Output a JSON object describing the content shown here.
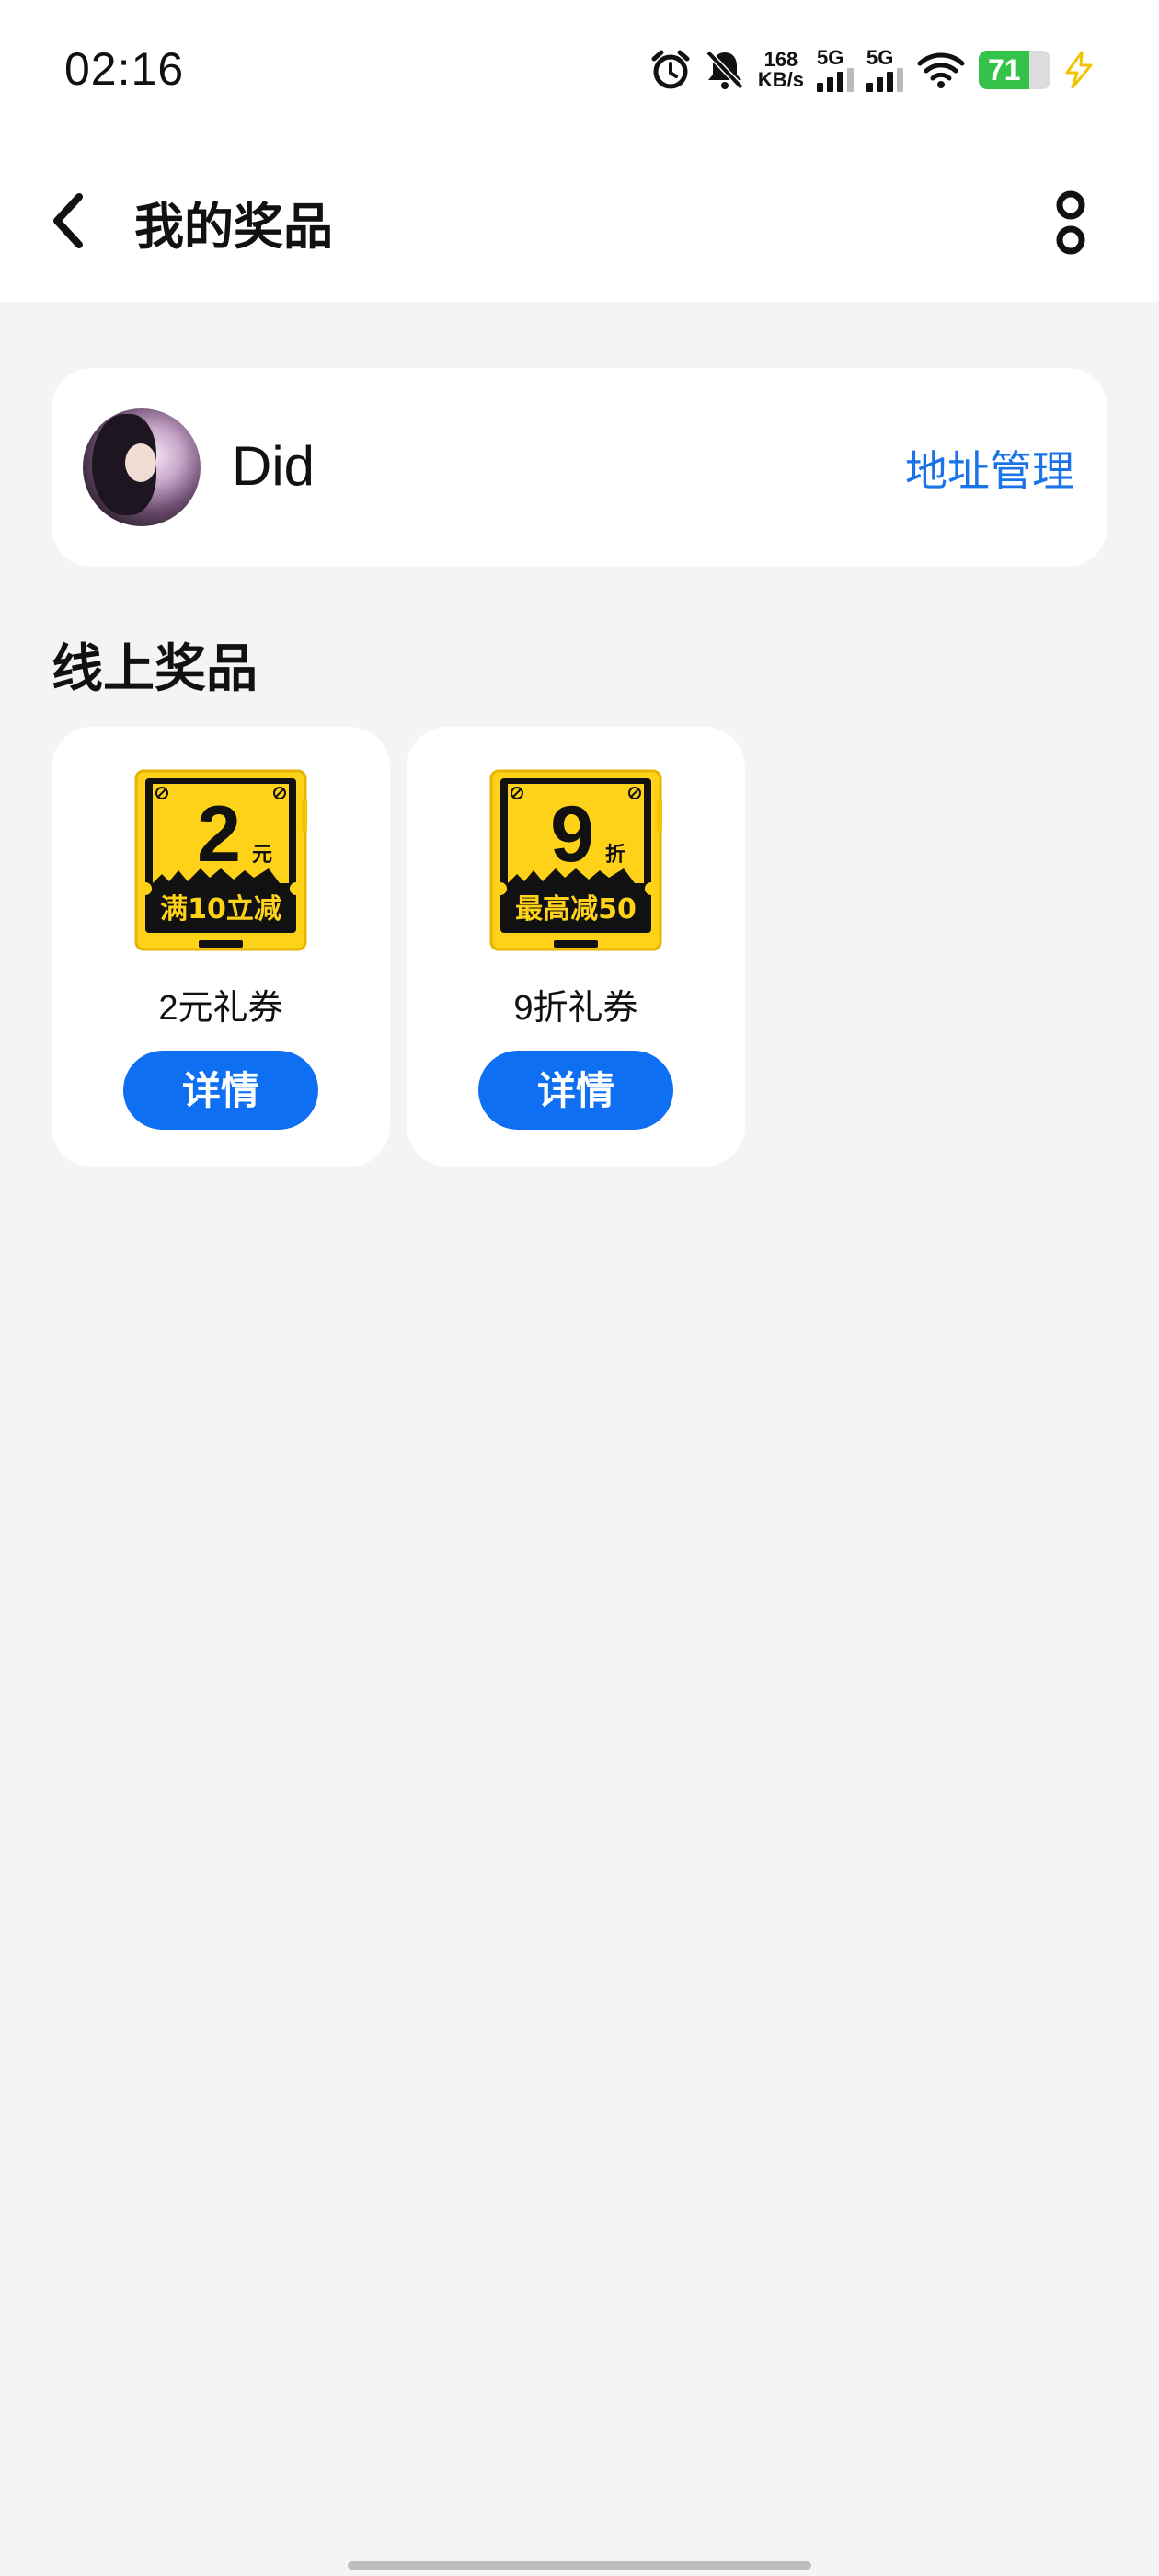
{
  "status_bar": {
    "time": "02:16",
    "net_speed_value": "168",
    "net_speed_unit": "KB/s",
    "sim1_label": "5G",
    "sim2_label": "5G",
    "battery_percent": "71",
    "battery_color": "#35c24a"
  },
  "header": {
    "title": "我的奖品",
    "back_icon": "chevron-left-icon",
    "more_icon": "more-vertical-icon"
  },
  "profile": {
    "username": "Did",
    "address_link": "地址管理"
  },
  "section": {
    "online_prizes_title": "线上奖品"
  },
  "prizes": [
    {
      "coupon_big": "2",
      "coupon_unit": "元",
      "coupon_caption": "满10立减",
      "name": "2元礼券",
      "button_label": "详情"
    },
    {
      "coupon_big": "9",
      "coupon_unit": "折",
      "coupon_caption": "最高减50",
      "name": "9折礼券",
      "button_label": "详情"
    }
  ],
  "colors": {
    "accent": "#0f6ff3",
    "link": "#1a73e8",
    "coupon_yellow": "#ffd21a",
    "background": "#f4f4f4"
  }
}
